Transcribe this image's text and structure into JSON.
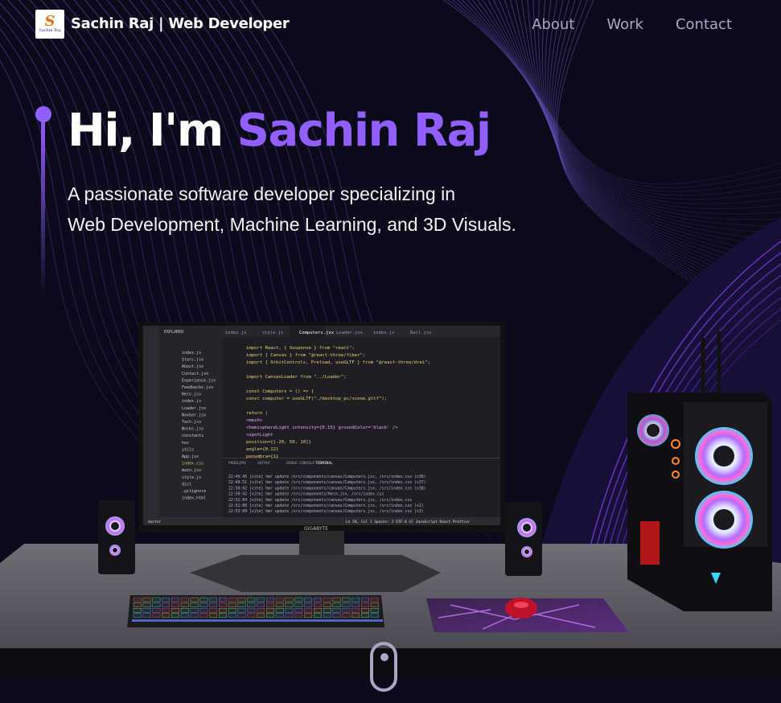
{
  "nav": {
    "logo_glyph": "S",
    "logo_caption": "Sachin Raj",
    "brand": "Sachin Raj  | Web Developer",
    "links": [
      {
        "label": "About"
      },
      {
        "label": "Work"
      },
      {
        "label": "Contact"
      }
    ]
  },
  "hero": {
    "greeting": "Hi, I'm ",
    "name": "Sachin Raj",
    "line1": "A passionate software developer specializing in",
    "line2": "Web Development, Machine Learning, and 3D Visuals."
  },
  "monitor": {
    "brand": "GIGABYTE",
    "tabs": [
      "index.js",
      "style.js",
      "Computers.jsx",
      "Loader.jsx",
      "index.js",
      "Ball.jsx"
    ],
    "explorer_title": "EXPLORER",
    "files": [
      "index.js",
      "Stars.jsx",
      "About.jsx",
      "Contact.jsx",
      "Experience.jsx",
      "Feedbacks.jsx",
      "Hero.jsx",
      "index.js",
      "Loader.jsx",
      "Navbar.jsx",
      "Tech.jsx",
      "Works.jsx",
      "constants",
      "hoc",
      "utils",
      "App.jsx",
      "index.css",
      "main.jsx",
      "style.js",
      "dist",
      ".gitignore",
      "index.html"
    ],
    "code": [
      "import React, { Suspense } from \"react\";",
      "import { Canvas } from \"@react-three/fiber\";",
      "import { OrbitControls, Preload, useGLTF } from \"@react-three/drei\";",
      "",
      "import CanvasLoader from \"../Loader\";",
      "",
      "const Computers = () => {",
      "  const computer = useGLTF(\"./desktop_pc/scene.gltf\");",
      "",
      "  return (",
      "    <mesh>",
      "      <hemisphereLight intensity={0.15} groundColor='black' />",
      "      <spotLight",
      "        position={[-20, 50, 10]}",
      "        angle={0.12}",
      "        penumbra={1}"
    ],
    "terminal_tabs": [
      "PROBLEMS",
      "OUTPUT",
      "DEBUG CONSOLE",
      "TERMINAL"
    ],
    "terminal": [
      "22:49:45 [vite] hmr update /src/components/canvas/Computers.jsx, /src/index.css (x36)",
      "22:49:51 [vite] hmr update /src/components/canvas/Computers.jsx, /src/index.css (x37)",
      "22:50:02 [vite] hmr update /src/components/canvas/Computers.jsx, /src/index.css (x38)",
      "22:50:42 [vite] hmr update /src/components/Hero.jsx, /src/index.css",
      "22:51:04 [vite] hmr update /src/components/canvas/Computers.jsx, /src/index.css",
      "22:52:00 [vite] hmr update /src/components/canvas/Computers.jsx, /src/index.css (x2)",
      "22:53:09 [vite] hmr update /src/components/canvas/Computers.jsx, /src/index.css (x3)"
    ],
    "status_left": "master",
    "status_right": "Ln 50, Col 1   Spaces: 2   UTF-8   LF   JavaScript React   Prettier"
  },
  "colors": {
    "accent": "#915eff",
    "background": "#0b0a1a",
    "nav_text": "#aaa6c3"
  },
  "icons": [
    "logo-icon",
    "mouse-scroll-icon"
  ]
}
